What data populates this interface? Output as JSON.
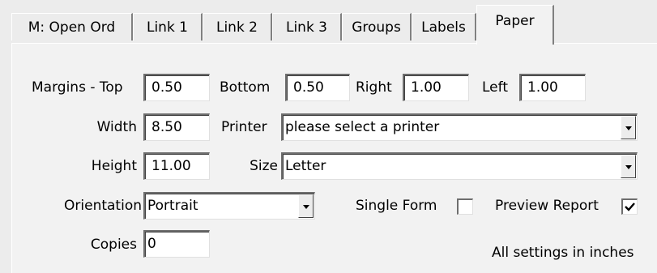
{
  "tabs": [
    {
      "label": "M: Open Ord",
      "active": false
    },
    {
      "label": "Link 1",
      "active": false
    },
    {
      "label": "Link 2",
      "active": false
    },
    {
      "label": "Link 3",
      "active": false
    },
    {
      "label": "Groups",
      "active": false
    },
    {
      "label": "Labels",
      "active": false
    },
    {
      "label": "Paper",
      "active": true
    }
  ],
  "margins": {
    "top_label": "Margins - Top",
    "top_value": "0.50",
    "bottom_label": "Bottom",
    "bottom_value": "0.50",
    "right_label": "Right",
    "right_value": "1.00",
    "left_label": "Left",
    "left_value": "1.00"
  },
  "width": {
    "label": "Width",
    "value": "8.50"
  },
  "height": {
    "label": "Height",
    "value": "11.00"
  },
  "printer": {
    "label": "Printer",
    "value": "please select a printer"
  },
  "size": {
    "label": "Size",
    "value": "Letter"
  },
  "orientation": {
    "label": "Orientation",
    "value": "Portrait"
  },
  "single_form": {
    "label": "Single Form",
    "checked": false
  },
  "preview_report": {
    "label": "Preview Report",
    "checked": true
  },
  "copies": {
    "label": "Copies",
    "value": "0"
  },
  "note": "All settings in inches",
  "icons": {
    "dropdown": "chevron-down-icon",
    "check": "checkmark-icon"
  }
}
